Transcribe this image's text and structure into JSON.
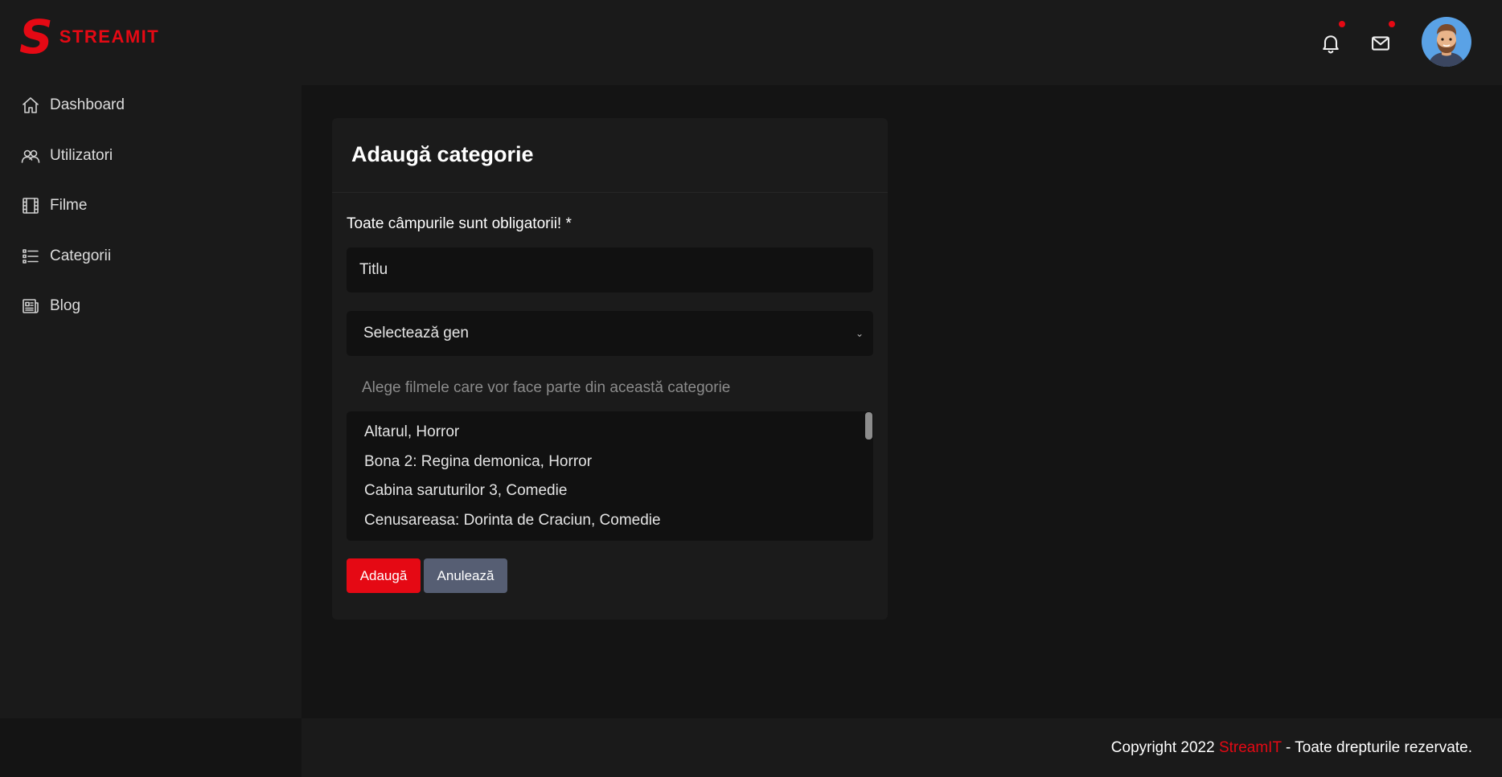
{
  "brand": {
    "logo_letter": "S",
    "name": "STREAMIT"
  },
  "sidebar": {
    "items": [
      {
        "label": "Dashboard",
        "icon": "home-icon"
      },
      {
        "label": "Utilizatori",
        "icon": "users-icon"
      },
      {
        "label": "Filme",
        "icon": "film-icon"
      },
      {
        "label": "Categorii",
        "icon": "list-icon"
      },
      {
        "label": "Blog",
        "icon": "newspaper-icon"
      }
    ]
  },
  "header": {
    "icons": [
      "bell-icon",
      "mail-icon"
    ],
    "has_notifications": true,
    "has_messages": true
  },
  "form": {
    "title": "Adaugă categorie",
    "required_note": "Toate câmpurile sunt obligatorii! *",
    "title_value": "Titlu",
    "genre_select": "Selectează gen",
    "movies_label": "Alege filmele care vor face parte din această categorie",
    "movies": [
      "Altarul,  Horror",
      "Bona 2: Regina demonica,  Horror",
      "Cabina saruturilor 3,  Comedie",
      "Cenusareasa: Dorinta de Craciun,  Comedie"
    ],
    "submit_label": "Adaugă",
    "cancel_label": "Anulează"
  },
  "footer": {
    "prefix": "Copyright 2022 ",
    "brand": "StreamIT",
    "suffix": " - Toate drepturile rezervate."
  },
  "colors": {
    "accent": "#e50914",
    "background": "#141414",
    "panel": "#1a1a1a",
    "secondary_button": "#565e73"
  }
}
